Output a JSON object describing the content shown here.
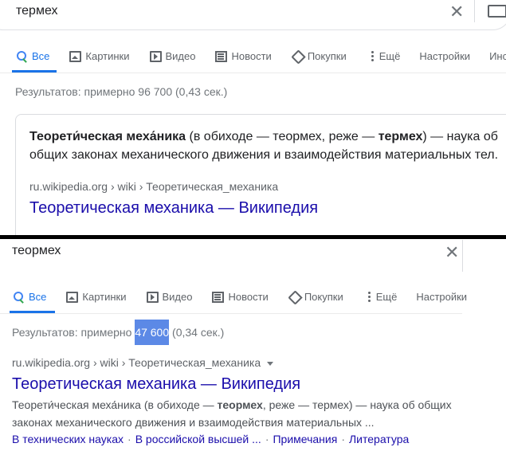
{
  "top": {
    "query": "термех",
    "tabs": [
      {
        "label": "Все",
        "icon": "search-icon"
      },
      {
        "label": "Картинки",
        "icon": "image-icon"
      },
      {
        "label": "Видео",
        "icon": "video-icon"
      },
      {
        "label": "Новости",
        "icon": "news-icon"
      },
      {
        "label": "Покупки",
        "icon": "tag-icon"
      },
      {
        "label": "Ещё",
        "icon": "more-icon"
      },
      {
        "label": "Настройки"
      },
      {
        "label": "Инст"
      }
    ],
    "stats": "Результатов: примерно 96 700 (0,43 сек.)",
    "snippet": {
      "bold1": "Теорети́ческая меха́ника",
      "text1": " (в обиходе — теормех, реже — ",
      "bold2": "термех",
      "text2": ") — наука об общих законах механического движения и взаимодействия материальных тел."
    },
    "cite": "ru.wikipedia.org › wiki › Теоретическая_механика",
    "title": "Теоретическая механика — Википедия"
  },
  "bottom": {
    "query": "теормех",
    "tabs": [
      {
        "label": "Все",
        "icon": "search-icon"
      },
      {
        "label": "Картинки",
        "icon": "image-icon"
      },
      {
        "label": "Видео",
        "icon": "video-icon"
      },
      {
        "label": "Новости",
        "icon": "news-icon"
      },
      {
        "label": "Покупки",
        "icon": "tag-icon"
      },
      {
        "label": "Ещё",
        "icon": "more-icon"
      },
      {
        "label": "Настройки"
      }
    ],
    "stats_pre": "Результатов: примерно ",
    "stats_hl": "47 600",
    "stats_post": " (0,34 сек.)",
    "cite": "ru.wikipedia.org › wiki › Теоретическая_механика",
    "title": "Теоретическая механика — Википедия",
    "desc": {
      "text1": "Теорети́ческая меха́ника (в обиходе — ",
      "bold": "теормех",
      "text2": ", реже — термех) — наука об общих законах механического движения и взаимодействия материальных ..."
    },
    "sitelinks": [
      "В технических науках",
      "В российской высшей ...",
      "Примечания",
      "Литература"
    ]
  },
  "colors": {
    "accent": "#1a73e8",
    "link": "#1a0dab",
    "highlight": "#5c89e6"
  }
}
